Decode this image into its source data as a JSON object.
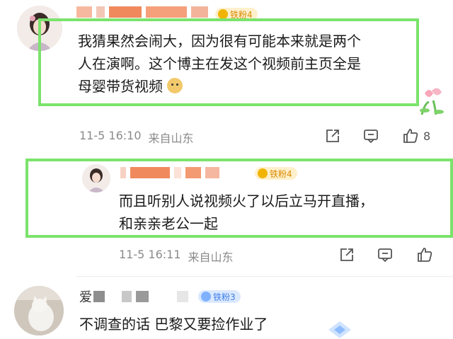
{
  "comment1": {
    "badge": "铁粉4",
    "text_line1": "我猜果然会闹大，因为很有可能本来就是两个",
    "text_line2": "人在演啊。这个博主在发这个视频前主页全是",
    "text_line3": "母婴带货视频",
    "date": "11-5 16:10",
    "location": "来自山东",
    "likes": "8"
  },
  "reply1": {
    "badge": "铁粉4",
    "text_line1": "而且听别人说视频火了以后立马开直播，",
    "text_line2": "和亲亲老公一起",
    "date": "11-5 16:11",
    "location": "来自山东"
  },
  "comment2": {
    "name_partial": "爱",
    "badge": "铁粉3",
    "text": "不调查的话 巴黎又要捡作业了"
  },
  "colors": {
    "highlight": "#7be36c",
    "meta": "#8a8a8a",
    "badge_blue": "#3d7ee8",
    "badge_gold": "#d98a00"
  }
}
